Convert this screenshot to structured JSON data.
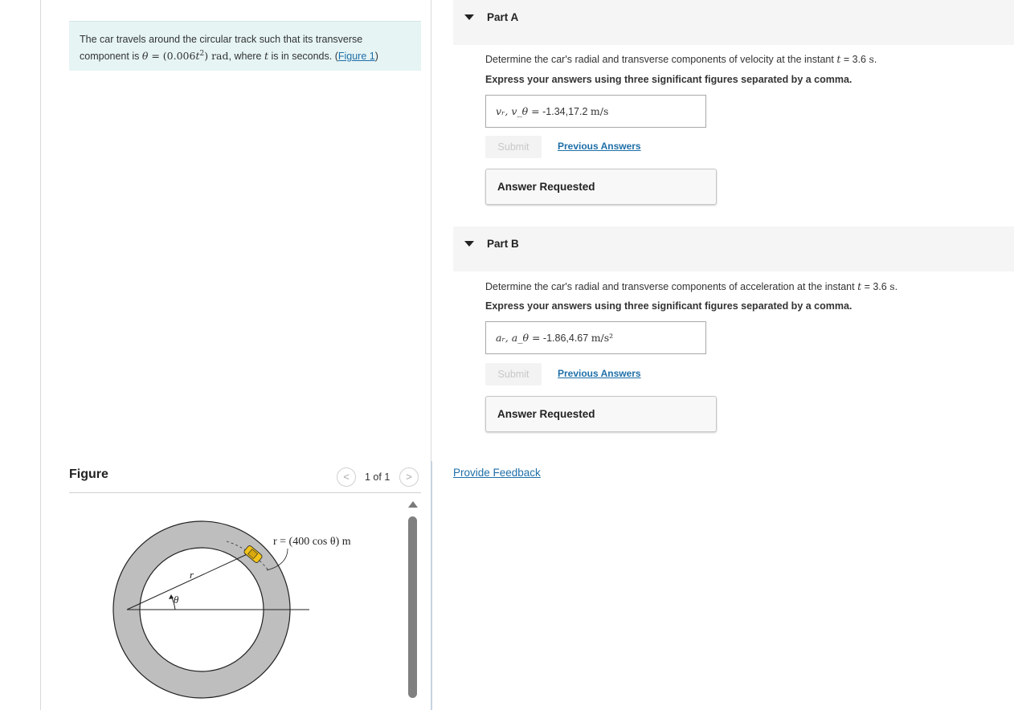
{
  "problem": {
    "text_before": "The car travels around the circular track such that its transverse component is ",
    "theta_sym": "θ",
    "equals": " = ",
    "expr_open": "(0.006",
    "var_t": "t",
    "expr_exp": "2",
    "expr_close": ")",
    "unit": " rad",
    "text_after_1": ", where ",
    "text_after_2": " is in seconds. (",
    "figure_link": "Figure 1",
    "close_paren": ")"
  },
  "figure": {
    "title": "Figure",
    "prev_glyph": "<",
    "next_glyph": ">",
    "counter": "1 of 1",
    "label_r_eq": "r = (400 cos θ) m",
    "label_r": "r",
    "label_theta": "θ",
    "colors": {
      "track": "#bebebe",
      "outline": "#222222"
    }
  },
  "partA": {
    "title": "Part A",
    "question_before": "Determine the car's radial and transverse components of velocity at the instant ",
    "t_sym": "t",
    "question_eq": " = 3.6 ",
    "question_unit": "s",
    "question_end": ".",
    "instruction": "Express your answers using three significant figures separated by a comma.",
    "answer_label": "vᵣ, v_θ =",
    "answer_value": "-1.34,17.2",
    "answer_unit": "m/s",
    "submit": "Submit",
    "previous": "Previous Answers",
    "requested": "Answer Requested"
  },
  "partB": {
    "title": "Part B",
    "question_before": "Determine the car's radial and transverse components of acceleration at the instant ",
    "t_sym": "t",
    "question_eq": " = 3.6 ",
    "question_unit": "s",
    "question_end": ".",
    "instruction": "Express your answers using three significant figures separated by a comma.",
    "answer_label": "aᵣ, a_θ =",
    "answer_value": "-1.86,4.67",
    "answer_unit": "m/s²",
    "submit": "Submit",
    "previous": "Previous Answers",
    "requested": "Answer Requested"
  },
  "feedback": "Provide Feedback"
}
